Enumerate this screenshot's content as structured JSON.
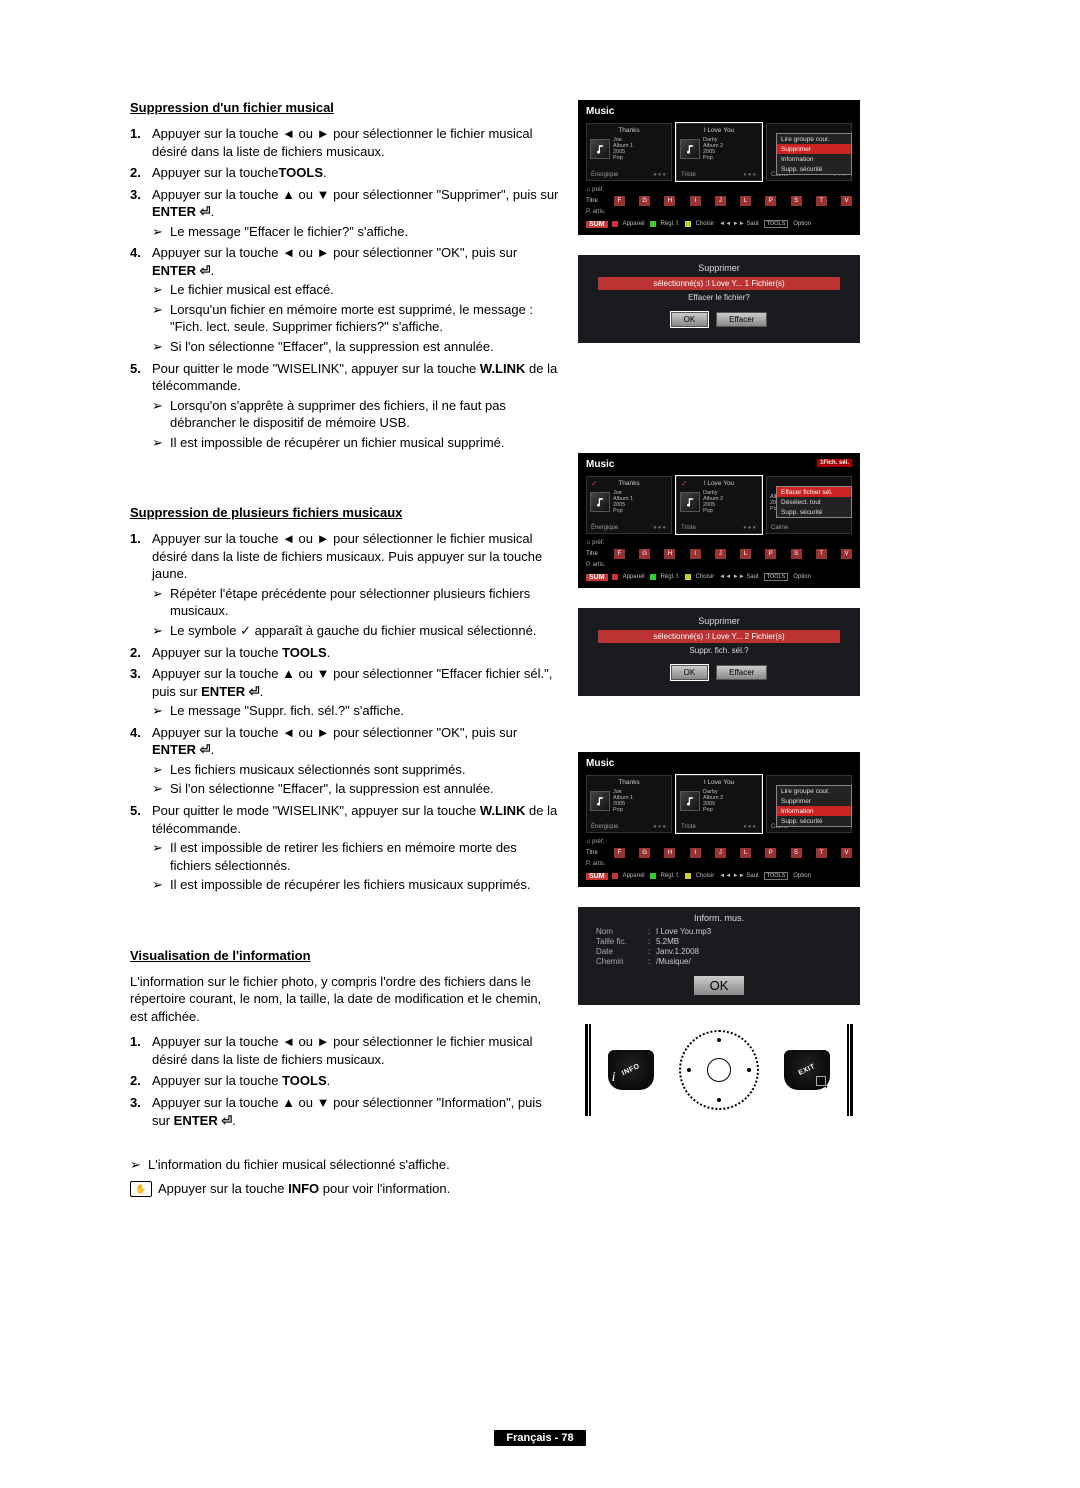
{
  "sections": {
    "s1": {
      "title": "Suppression d'un fichier musical",
      "steps": [
        {
          "num": "1.",
          "text": "Appuyer sur la touche ◄ ou ► pour sélectionner le fichier musical désiré dans la liste de fichiers musicaux."
        },
        {
          "num": "2.",
          "pre": "Appuyer sur la touche",
          "kw": "TOOLS",
          "post": "."
        },
        {
          "num": "3.",
          "text": "Appuyer sur la touche ▲ ou ▼ pour sélectionner \"Supprimer\", puis sur ",
          "kw": "ENTER ⏎",
          "post": ".",
          "subs": [
            "Le message \"Effacer le fichier?\" s'affiche."
          ]
        },
        {
          "num": "4.",
          "text": "Appuyer sur la touche ◄ ou ► pour sélectionner \"OK\", puis sur ",
          "kw": "ENTER ⏎",
          "post": ".",
          "subs": [
            "Le fichier musical est effacé.",
            "Lorsqu'un fichier en mémoire morte est supprimé, le message : \"Fich. lect. seule. Supprimer fichiers?\" s'affiche.",
            "Si l'on sélectionne \"Effacer\", la suppression est annulée."
          ]
        },
        {
          "num": "5.",
          "text": "Pour quitter le mode \"WISELINK\", appuyer sur la touche ",
          "kw": "W.LINK",
          "post": " de la télécommande.",
          "subs": [
            "Lorsqu'on s'apprête à supprimer des fichiers, il ne faut pas débrancher le dispositif de mémoire USB.",
            "Il est impossible de récupérer un fichier musical supprimé."
          ]
        }
      ]
    },
    "s2": {
      "title": "Suppression de plusieurs fichiers musicaux",
      "steps": [
        {
          "num": "1.",
          "text": "Appuyer sur la touche ◄ ou ► pour sélectionner le fichier musical désiré dans la liste de fichiers musicaux. Puis appuyer sur la touche jaune.",
          "subs": [
            "Répéter l'étape précédente pour sélectionner plusieurs fichiers musicaux.",
            "Le symbole ✓ apparaît à gauche du fichier musical sélectionné."
          ]
        },
        {
          "num": "2.",
          "text": "Appuyer sur la touche ",
          "kw": "TOOLS",
          "post": "."
        },
        {
          "num": "3.",
          "text": "Appuyer sur la touche ▲ ou ▼ pour sélectionner \"Effacer fichier sél.\", puis sur ",
          "kw": "ENTER ⏎",
          "post": ".",
          "subs": [
            "Le message \"Suppr. fich. sél.?\" s'affiche."
          ]
        },
        {
          "num": "4.",
          "text": "Appuyer sur la touche ◄ ou ► pour sélectionner \"OK\", puis sur ",
          "kw": "ENTER ⏎",
          "post": ".",
          "subs": [
            "Les fichiers musicaux sélectionnés sont supprimés.",
            "Si l'on sélectionne \"Effacer\", la suppression est annulée."
          ]
        },
        {
          "num": "5.",
          "text": "Pour quitter le mode \"WISELINK\", appuyer sur la touche ",
          "kw": "W.LINK",
          "post": " de la télécommande.",
          "subs": [
            "Il est impossible de retirer les fichiers en mémoire morte des fichiers sélectionnés.",
            "Il est impossible de récupérer les fichiers musicaux supprimés."
          ]
        }
      ]
    },
    "s3": {
      "title": "Visualisation de l'information",
      "intro": "L'information sur le fichier photo, y compris l'ordre des fichiers dans le répertoire courant, le nom, la taille, la date de modification et le chemin, est affichée.",
      "steps": [
        {
          "num": "1.",
          "text": "Appuyer sur la touche ◄ ou ► pour sélectionner le fichier musical désiré dans la liste de fichiers musicaux."
        },
        {
          "num": "2.",
          "text": "Appuyer sur la touche ",
          "kw": "TOOLS",
          "post": "."
        },
        {
          "num": "3.",
          "text": "Appuyer sur la touche ▲ ou ▼ pour sélectionner \"Information\", puis sur ",
          "kw": "ENTER ⏎",
          "post": "."
        }
      ],
      "after_sub": "L'information du fichier musical sélectionné s'affiche.",
      "note": "Appuyer sur la touche ",
      "note_kw": "INFO",
      "note_post": " pour voir l'information."
    }
  },
  "screens": {
    "common": {
      "music_header": "Music",
      "sum": "SUM",
      "legend_appareil": "Appareil",
      "legend_regl": "Régl. f.",
      "legend_choisir": "Choisir",
      "legend_saut": "◄◄ ►► Saut",
      "legend_tools": "TOOLS",
      "legend_option": "Option",
      "pref": "♫ préf.",
      "titre_label": "Titre",
      "artis_label": "P. artis.",
      "letters": [
        "F",
        "G",
        "H",
        "I",
        "J",
        "L",
        "P",
        "S",
        "T",
        "V"
      ],
      "albums": [
        {
          "top": "Thanks",
          "name": "Joe",
          "album": "Album 1",
          "year": "2005",
          "genre": "Pop",
          "mood": "Énergique"
        },
        {
          "top": "I Love You",
          "name": "Darby",
          "album": "Album 2",
          "year": "2005",
          "genre": "Pop",
          "mood": "Triste"
        },
        {
          "top": "",
          "name": "",
          "album": "Album 3",
          "year": "2005",
          "genre": "Pop",
          "mood": "Calme"
        }
      ]
    },
    "menu1": {
      "items": [
        "Lire groupe cour.",
        "Supprimer",
        "Information",
        "Supp. sécurité"
      ],
      "highlight": 1
    },
    "dialog1": {
      "title": "Supprimer",
      "sel": "sélectionné(s) :I Love Y...  1 Fichier(s)",
      "q": "Effacer le fichier?",
      "ok": "OK",
      "cancel": "Effacer"
    },
    "menu2": {
      "badge": "1Fich. sél.",
      "items": [
        "Effacer fichier sél.",
        "Désélect. tout",
        "Supp. sécurité"
      ],
      "highlight": 0
    },
    "dialog2": {
      "title": "Supprimer",
      "sel": "sélectionné(s) :I Love Y...  2 Fichier(s)",
      "q": "Suppr. fich. sél.?",
      "ok": "OK",
      "cancel": "Effacer"
    },
    "menu3": {
      "items": [
        "Lire groupe cour.",
        "Supprimer",
        "Information",
        "Supp. sécurité"
      ],
      "highlight": 2
    },
    "info": {
      "title": "Inform. mus.",
      "rows": [
        {
          "k": "Nom",
          "v": "I Love You.mp3"
        },
        {
          "k": "Taille fic.",
          "v": "5.2MB"
        },
        {
          "k": "Date",
          "v": "Janv.1.2008"
        },
        {
          "k": "Chemin",
          "v": "/Musique/"
        }
      ],
      "ok": "OK"
    }
  },
  "remote": {
    "info": "INFO",
    "exit": "EXIT"
  },
  "footer": "Français - 78"
}
